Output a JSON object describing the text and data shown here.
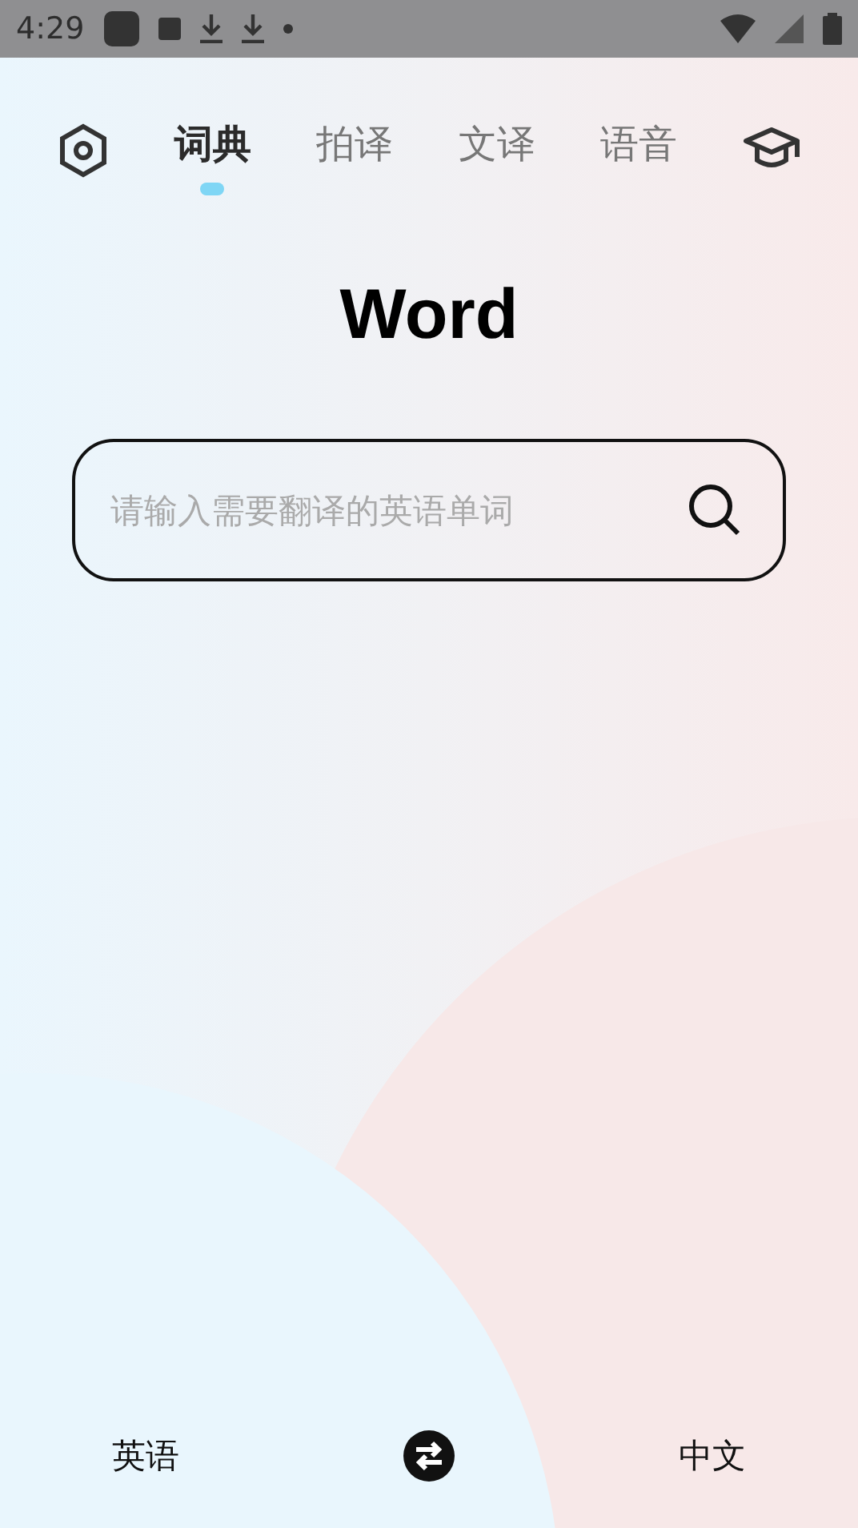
{
  "status_bar": {
    "time": "4:29"
  },
  "tabs": [
    {
      "label": "词典",
      "selected": true
    },
    {
      "label": "拍译",
      "selected": false
    },
    {
      "label": "文译",
      "selected": false
    },
    {
      "label": "语音",
      "selected": false
    }
  ],
  "title": "Word",
  "search": {
    "placeholder": "请输入需要翻译的英语单词"
  },
  "languages": {
    "source": "英语",
    "target": "中文"
  }
}
